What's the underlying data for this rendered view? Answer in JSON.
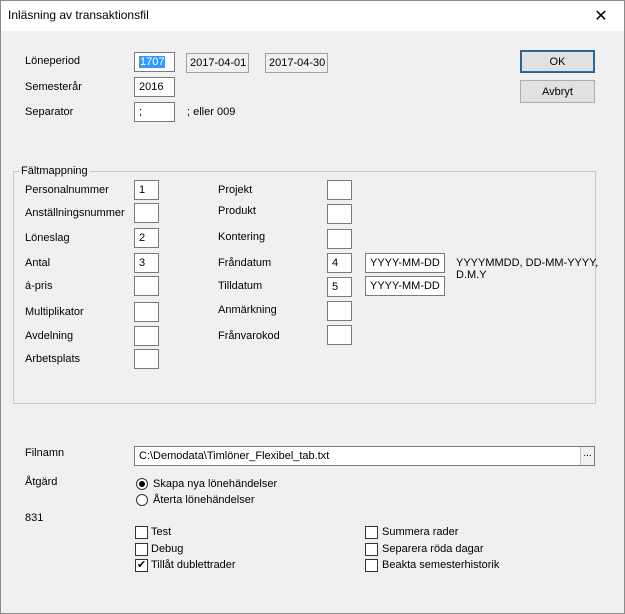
{
  "window": {
    "title": "Inläsning av transaktionsfil",
    "close_symbol": "✕"
  },
  "top": {
    "loneperiod_label": "Löneperiod",
    "loneperiod_value": "1707",
    "from_date": "2017-04-01",
    "to_date": "2017-04-30",
    "semesterar_label": "Semesterår",
    "semesterar_value": "2016",
    "separator_label": "Separator",
    "separator_value": ";",
    "separator_hint": "; eller 009"
  },
  "buttons": {
    "ok": "OK",
    "cancel": "Avbryt"
  },
  "mapping": {
    "legend": "Fältmappning",
    "left": [
      {
        "label": "Personalnummer",
        "value": "1"
      },
      {
        "label": "Anställningsnummer",
        "value": ""
      },
      {
        "label": "Löneslag",
        "value": "2"
      },
      {
        "label": "Antal",
        "value": "3"
      },
      {
        "label": "á-pris",
        "value": ""
      },
      {
        "label": "Multiplikator",
        "value": ""
      },
      {
        "label": "Avdelning",
        "value": ""
      },
      {
        "label": "Arbetsplats",
        "value": ""
      }
    ],
    "right": [
      {
        "label": "Projekt",
        "value": ""
      },
      {
        "label": "Produkt",
        "value": ""
      },
      {
        "label": "Kontering",
        "value": ""
      },
      {
        "label": "Fråndatum",
        "value": "4",
        "format": "YYYY-MM-DD"
      },
      {
        "label": "Tilldatum",
        "value": "5",
        "format": "YYYY-MM-DD"
      },
      {
        "label": "Anmärkning",
        "value": ""
      },
      {
        "label": "Frånvarokod",
        "value": ""
      }
    ],
    "date_formats_hint_line1": "YYYYMMDD, DD-MM-YYYY,",
    "date_formats_hint_line2": "D.M.Y"
  },
  "file": {
    "label": "Filnamn",
    "path": "C:\\Demodata\\Timlöner_Flexibel_tab.txt",
    "browse_label": "..."
  },
  "action": {
    "label": "Åtgärd",
    "options": [
      {
        "label": "Skapa nya lönehändelser",
        "selected": true
      },
      {
        "label": "Återta lönehändelser",
        "selected": false
      }
    ],
    "count": "831"
  },
  "options": {
    "left": [
      {
        "label": "Test",
        "checked": false
      },
      {
        "label": "Debug",
        "checked": false
      },
      {
        "label": "Tillåt dublettrader",
        "checked": true
      }
    ],
    "right": [
      {
        "label": "Summera rader",
        "checked": false
      },
      {
        "label": "Separera röda dagar",
        "checked": false
      },
      {
        "label": "Beakta semesterhistorik",
        "checked": false
      }
    ]
  },
  "icons": {
    "close": "close-icon",
    "browse": "browse-icon",
    "check": "checkmark-icon"
  }
}
